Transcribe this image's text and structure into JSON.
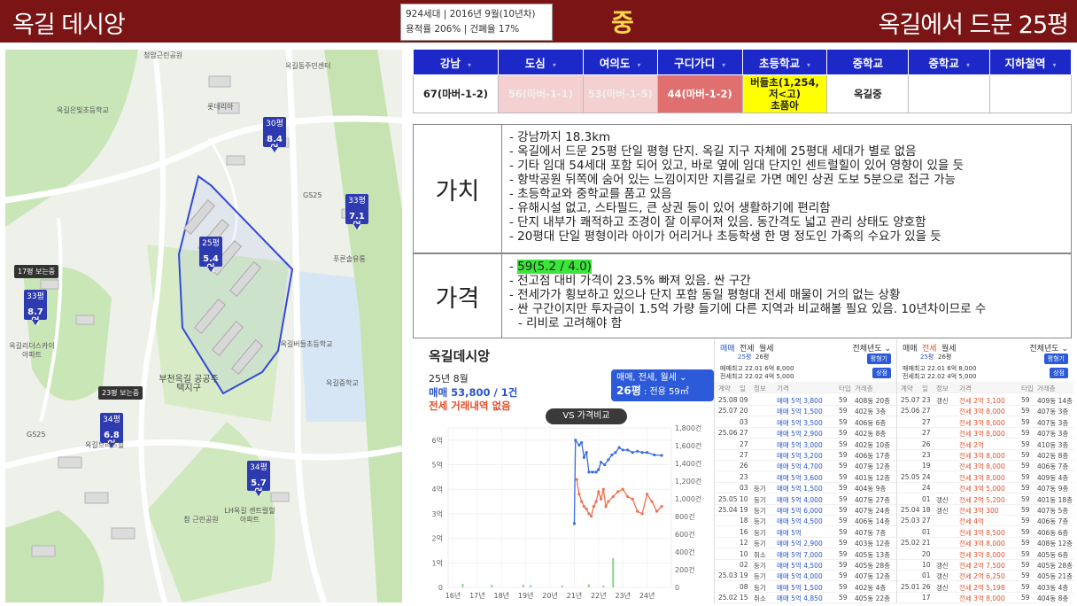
{
  "header": {
    "left": "옥길 데시앙",
    "center": "중",
    "right": "옥길에서 드문 25평",
    "info_line1": "924세대 | 2016년 9월(10년차)",
    "info_line2": "용적률 206% | 건폐율 17%"
  },
  "map": {
    "pins": [
      {
        "small": "30평",
        "value": "8.4억"
      },
      {
        "small": "33평",
        "value": "7.1억"
      },
      {
        "small": "25평",
        "value": "5.4억"
      },
      {
        "small": "33평",
        "value": "8.7억"
      },
      {
        "small": "34평",
        "value": "6.8억"
      },
      {
        "small": "34평",
        "value": "5.7억"
      }
    ],
    "tags": [
      "17평 보는중",
      "23평 보는중"
    ],
    "labels": [
      "청암근린공원",
      "옥길동주민센터",
      "롯데리아",
      "옥길은빛초등학교",
      "GS25",
      "푸른솔유통",
      "옥길버들초등학교",
      "옥길중학교",
      "부천옥길 공공주택지구",
      "옥길브리즈힐",
      "GS25",
      "참 근린공원",
      "LH옥길 센트럴힐아파트",
      "옥길리더스카이 아파트"
    ]
  },
  "table": {
    "headers": [
      "강남",
      "도심",
      "여의도",
      "구디가디",
      "초등학교",
      "중학교",
      "중학교",
      "지하철역"
    ],
    "cells": [
      "67(마버-1-2)",
      "56(마버-1-1)",
      "53(마버-1-5)",
      "44(마버-1-2)",
      "버들초(1,254,\n저<고)\n초품아",
      "옥길중",
      "",
      ""
    ]
  },
  "value_section": {
    "label": "가치",
    "items": [
      "강남까지 18.3km",
      "옥길에서 드문 25평 단일 평형 단지. 옥길 지구 자체에 25평대 세대가 별로 없음",
      "기타 임대 54세대 포함 되어 있고, 바로 옆에 임대 단지인 센트럴힐이 있어 영향이 있을 듯",
      "항박공원 뒤쪽에 숨어 있는 느낌이지만 지름길로 가면 메인 상권 도보 5분으로 접근 가능",
      "초등학교와 중학교를 품고 있음",
      "유해시설 없고, 스타필드, 큰 상권 등이 있어 생활하기에 편리함",
      "단지 내부가 쾌적하고 조경이 잘 이루어져 있음. 동간격도 넓고 관리 상태도 양호함",
      "20평대 단일 평형이라 아이가 어리거나 초등학생 한 명 정도인 가족의 수요가 있을 듯"
    ]
  },
  "price_section": {
    "label": "가격",
    "highlight": "59(5.2 / 4.0)",
    "items": [
      "전고점 대비 가격이 23.5% 빠져 있음. 싼 구간",
      "전세가가 횡보하고 있으나 단지 포함 동일 평형대 전세 매물이 거의 없는 상황",
      "싼 구간이지만 투자금이 1.5억 가량 들기에 다른 지역과 비교해볼 필요 있음. 10년차이므로 수",
      "리비로 고려해야 함"
    ]
  },
  "chart_panel": {
    "title": "옥길데시앙",
    "close": "×",
    "month": "25년 8월",
    "sale": "매매 53,800 / 1건",
    "lease": "전세 거래내역 없음",
    "select_line1": "매매, 전세, 월세 ⌄",
    "select_line2": "26평",
    "select_line2b": " : 전용 59㎡",
    "vs_button": "VS 가격비교"
  },
  "chart_data": {
    "type": "line",
    "x_ticks": [
      "16년",
      "17년",
      "18년",
      "19년",
      "20년",
      "21년",
      "22년",
      "23년",
      "24년"
    ],
    "y_left_ticks": [
      "0",
      "1억",
      "2억",
      "3억",
      "4억",
      "5억",
      "6억"
    ],
    "y_right_ticks": [
      "0",
      "200건",
      "400건",
      "600건",
      "800건",
      "1,000건",
      "1,200건",
      "1,400건",
      "1,600건",
      "1,800건"
    ],
    "ylim_left": [
      0,
      6.5
    ],
    "ylim_right": [
      0,
      1800
    ],
    "series": [
      {
        "name": "매매",
        "color": "#3a6ee0",
        "points": [
          [
            2021.0,
            2.6
          ],
          [
            2021.05,
            6.0
          ],
          [
            2021.2,
            5.8
          ],
          [
            2021.3,
            5.9
          ],
          [
            2021.4,
            5.3
          ],
          [
            2021.5,
            5.5
          ],
          [
            2021.6,
            4.7
          ],
          [
            2021.75,
            4.7
          ],
          [
            2021.9,
            4.7
          ],
          [
            2022.0,
            4.8
          ],
          [
            2022.1,
            5.1
          ],
          [
            2022.25,
            5.0
          ],
          [
            2022.4,
            5.2
          ],
          [
            2022.55,
            5.4
          ],
          [
            2022.7,
            5.5
          ],
          [
            2022.85,
            5.7
          ],
          [
            2023.0,
            5.6
          ],
          [
            2023.2,
            5.6
          ],
          [
            2023.4,
            5.5
          ],
          [
            2023.6,
            5.55
          ],
          [
            2023.8,
            5.5
          ],
          [
            2024.0,
            5.5
          ],
          [
            2024.3,
            5.4
          ],
          [
            2024.6,
            5.38
          ]
        ]
      },
      {
        "name": "전세",
        "color": "#f07050",
        "points": [
          [
            2021.1,
            4.4
          ],
          [
            2021.2,
            3.8
          ],
          [
            2021.3,
            3.5
          ],
          [
            2021.4,
            3.3
          ],
          [
            2021.5,
            3.2
          ],
          [
            2021.6,
            3.0
          ],
          [
            2021.7,
            2.9
          ],
          [
            2021.8,
            3.3
          ],
          [
            2021.9,
            3.5
          ],
          [
            2022.0,
            3.9
          ],
          [
            2022.1,
            3.6
          ],
          [
            2022.2,
            4.0
          ],
          [
            2022.3,
            3.3
          ],
          [
            2022.4,
            3.5
          ],
          [
            2022.6,
            3.7
          ],
          [
            2022.8,
            3.9
          ],
          [
            2023.0,
            4.0
          ],
          [
            2023.2,
            3.7
          ],
          [
            2023.4,
            3.6
          ],
          [
            2023.6,
            3.1
          ],
          [
            2023.8,
            3.0
          ],
          [
            2024.0,
            3.8
          ],
          [
            2024.2,
            3.5
          ],
          [
            2024.4,
            3.1
          ],
          [
            2024.6,
            3.3
          ]
        ]
      }
    ],
    "volume_bars": [
      [
        2016.4,
        40
      ],
      [
        2017.6,
        30
      ],
      [
        2018.9,
        30
      ],
      [
        2019.2,
        25
      ],
      [
        2020.5,
        20
      ],
      [
        2021.6,
        35
      ],
      [
        2022.2,
        20
      ],
      [
        2022.6,
        330
      ]
    ]
  },
  "listing_left": {
    "tabs": [
      "매매",
      "전세",
      "월세"
    ],
    "dropdown": "전체년도 ⌄",
    "area1": "25평",
    "area2": "26평",
    "stat1": "매매최고 22.01 6억 8,000",
    "stat2": "전세최고 22.02 4억 5,000",
    "btn1": "평형기",
    "btn2": "상점",
    "cols": [
      "계약",
      "일",
      "정보",
      "가격",
      "타입",
      "거래층"
    ],
    "rows": [
      [
        "25.08",
        "09",
        "",
        "매매 5억 3,800",
        "59",
        "408동 20층"
      ],
      [
        "25.07",
        "20",
        "",
        "매매 5억 1,500",
        "59",
        "402동 3층"
      ],
      [
        "",
        "03",
        "",
        "매매 5억 3,500",
        "59",
        "406동 6층"
      ],
      [
        "25.06",
        "27",
        "",
        "매매 5억 2,900",
        "59",
        "402동 8층"
      ],
      [
        "",
        "27",
        "",
        "매매 5억 3,000",
        "59",
        "402동 10층"
      ],
      [
        "",
        "27",
        "",
        "매매 5억 3,200",
        "59",
        "406동 17층"
      ],
      [
        "",
        "26",
        "",
        "매매 5억 4,700",
        "59",
        "407동 12층"
      ],
      [
        "",
        "23",
        "",
        "매매 5억 3,600",
        "59",
        "401동 12층"
      ],
      [
        "",
        "03",
        "등기",
        "매매 5억 1,500",
        "59",
        "404동 9층"
      ],
      [
        "25.05",
        "10",
        "등기",
        "매매 5억 4,000",
        "59",
        "407동 27층"
      ],
      [
        "25.04",
        "19",
        "등기",
        "매매 5억 6,000",
        "59",
        "407동 24층"
      ],
      [
        "",
        "18",
        "등기",
        "매매 5억 4,500",
        "59",
        "406동 14층"
      ],
      [
        "",
        "16",
        "등기",
        "매매 5억",
        "59",
        "407동 7층"
      ],
      [
        "",
        "12",
        "등기",
        "매매 5억 2,900",
        "59",
        "403동 12층"
      ],
      [
        "",
        "10",
        "취소",
        "매매 5억 7,000",
        "59",
        "405동 13층"
      ],
      [
        "",
        "02",
        "등기",
        "매매 5억 4,500",
        "59",
        "405동 28층"
      ],
      [
        "25.03",
        "19",
        "등기",
        "매매 5억 4,000",
        "59",
        "407동 12층"
      ],
      [
        "",
        "08",
        "등기",
        "매매 5억 1,500",
        "59",
        "402동 4층"
      ],
      [
        "25.02",
        "15",
        "취소",
        "매매 5억 4,850",
        "59",
        "405동 22층"
      ]
    ]
  },
  "listing_right": {
    "tabs": [
      "매매",
      "전세",
      "월세"
    ],
    "dropdown": "전체년도 ⌄",
    "area1": "25평",
    "area2": "26평",
    "stat1": "매매최고 22.01 6억 8,000",
    "stat2": "전세최고 22.02 4억 5,000",
    "btn1": "평형기",
    "btn2": "상점",
    "cols": [
      "계약",
      "일",
      "정보",
      "가격",
      "타입",
      "거래층"
    ],
    "rows": [
      [
        "25.07",
        "23",
        "갱신",
        "전세 2억 3,100",
        "59",
        "409동 14층"
      ],
      [
        "25.06",
        "27",
        "",
        "전세 3억 8,000",
        "59",
        "407동 3층"
      ],
      [
        "",
        "27",
        "",
        "전세 3억 8,000",
        "59",
        "407동 3층"
      ],
      [
        "",
        "27",
        "",
        "전세 3억 8,000",
        "59",
        "407동 3층"
      ],
      [
        "",
        "26",
        "",
        "전세 2억",
        "59",
        "410동 3층"
      ],
      [
        "",
        "23",
        "",
        "전세 3억 8,000",
        "59",
        "402동 8층"
      ],
      [
        "",
        "19",
        "",
        "전세 3억 8,000",
        "59",
        "406동 7층"
      ],
      [
        "25.05",
        "24",
        "",
        "전세 3억 8,000",
        "59",
        "409동 4층"
      ],
      [
        "",
        "24",
        "",
        "전세 3억 5,000",
        "59",
        "407동 9층"
      ],
      [
        "",
        "01",
        "갱신",
        "전세 2억 5,200",
        "59",
        "401동 18층"
      ],
      [
        "25.04",
        "18",
        "갱신",
        "전세 3억 300",
        "59",
        "407동 5층"
      ],
      [
        "25.03",
        "27",
        "",
        "전세 4억",
        "59",
        "406동 7층"
      ],
      [
        "",
        "01",
        "",
        "전세 3억 8,500",
        "59",
        "406동 6층"
      ],
      [
        "25.02",
        "21",
        "",
        "전세 3억 8,000",
        "59",
        "408동 12층"
      ],
      [
        "",
        "20",
        "",
        "전세 3억 8,000",
        "59",
        "405동 6층"
      ],
      [
        "",
        "10",
        "갱신",
        "전세 2억 7,500",
        "59",
        "405동 28층"
      ],
      [
        "",
        "01",
        "갱신",
        "전세 2억 6,250",
        "59",
        "405동 21층"
      ],
      [
        "25.01",
        "26",
        "갱신",
        "전세 2억 5,198",
        "59",
        "403동 4층"
      ],
      [
        "",
        "17",
        "",
        "전세 3억 8,000",
        "59",
        "404동 8층"
      ]
    ]
  }
}
